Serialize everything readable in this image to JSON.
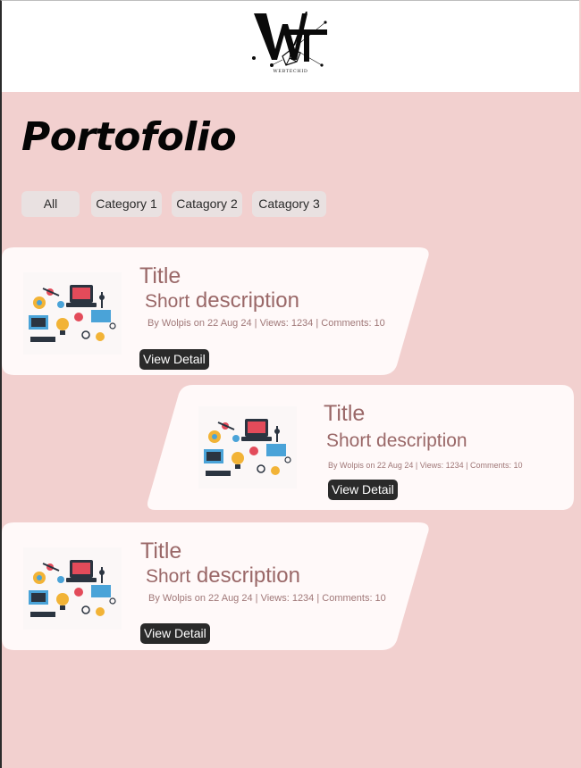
{
  "brand": {
    "logo_caption": "WEBTECHID"
  },
  "page_title": "Portofolio",
  "filters": [
    {
      "label": "All"
    },
    {
      "label": "Category 1"
    },
    {
      "label": "Catagory 2"
    },
    {
      "label": "Catagory 3"
    }
  ],
  "cards": [
    {
      "title": "Title",
      "desc_small": "Short",
      "desc_large": "description",
      "meta": "By Wolpis on 22 Aug 24 | Views: 1234 | Comments: 10",
      "button": "View Detail",
      "thumb_icon": "science-tech-illustration-icon"
    },
    {
      "title": "Title",
      "desc_small": "Short",
      "desc_large": "description",
      "meta": "By Wolpis on 22 Aug 24 | Views: 1234 | Comments: 10",
      "button": "View Detail",
      "thumb_icon": "science-tech-illustration-icon"
    },
    {
      "title": "Title",
      "desc_small": "Short",
      "desc_large": "description",
      "meta": "By Wolpis on 22 Aug 24 | Views: 1234 | Comments: 10",
      "button": "View Detail",
      "thumb_icon": "science-tech-illustration-icon"
    }
  ],
  "colors": {
    "background": "#f2d0cf",
    "card": "#fff9f9",
    "text_accent": "#9a6868",
    "button": "#2a2a2a"
  }
}
